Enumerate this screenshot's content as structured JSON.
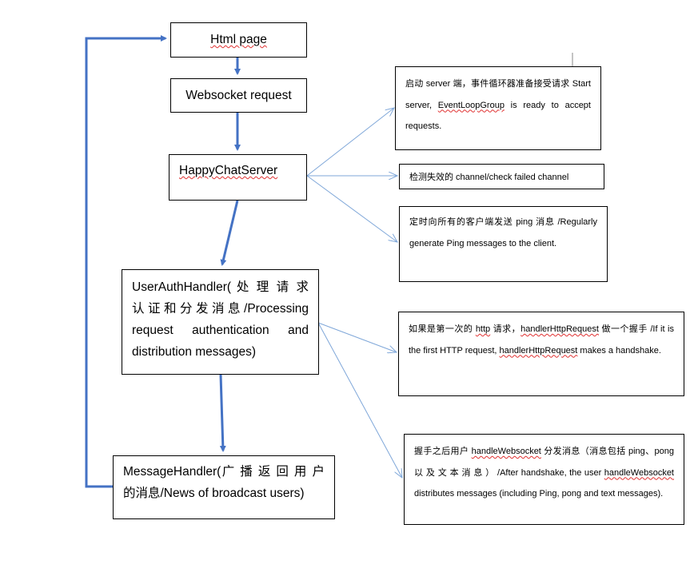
{
  "colors": {
    "flow_arrow": "#4472C4",
    "branch_arrow": "#7FA7D9",
    "border": "#000000"
  },
  "flow": [
    {
      "id": "html",
      "label": "Html page"
    },
    {
      "id": "ws",
      "label": "Websocket request"
    },
    {
      "id": "server",
      "label": "HappyChatServer"
    },
    {
      "id": "auth",
      "label": "UserAuthHandler( 处 理 请 求 认证和分发消息/Processing request authentication and distribution messages)"
    },
    {
      "id": "msg",
      "label": "MessageHandler(广 播 返 回 用 户 的消息/News of broadcast users)"
    }
  ],
  "notes": [
    {
      "pre": "启动 server 端，事件循环器准备接受请求 Start server, ",
      "sq": "EventLoopGroup",
      "post": " is ready to accept requests."
    },
    {
      "pre": "检测失效的 channel/check failed channel",
      "sq": "",
      "post": ""
    },
    {
      "pre": "定时向所有的客户端发送 ping 消息 /Regularly generate Ping messages to the client.",
      "sq": "",
      "post": ""
    },
    {
      "pre": "如果是第一次的 ",
      "sq": "http",
      "mid": " 请求，",
      "sq2": "handlerHttpRequest",
      "mid2": " 做一个握手 /If it is the first HTTP request, ",
      "sq3": "handlerHttpRequest",
      "post": " makes a handshake."
    },
    {
      "pre": "握手之后用户 ",
      "sq": "handleWebsocket",
      "mid": " 分发消息（消息包括 ping、pong 以 及 文 本 消 息 ） /After handshake, the user ",
      "sq2": "handleWebsocket",
      "post": " distributes messages (including Ping, pong and text messages)."
    }
  ]
}
